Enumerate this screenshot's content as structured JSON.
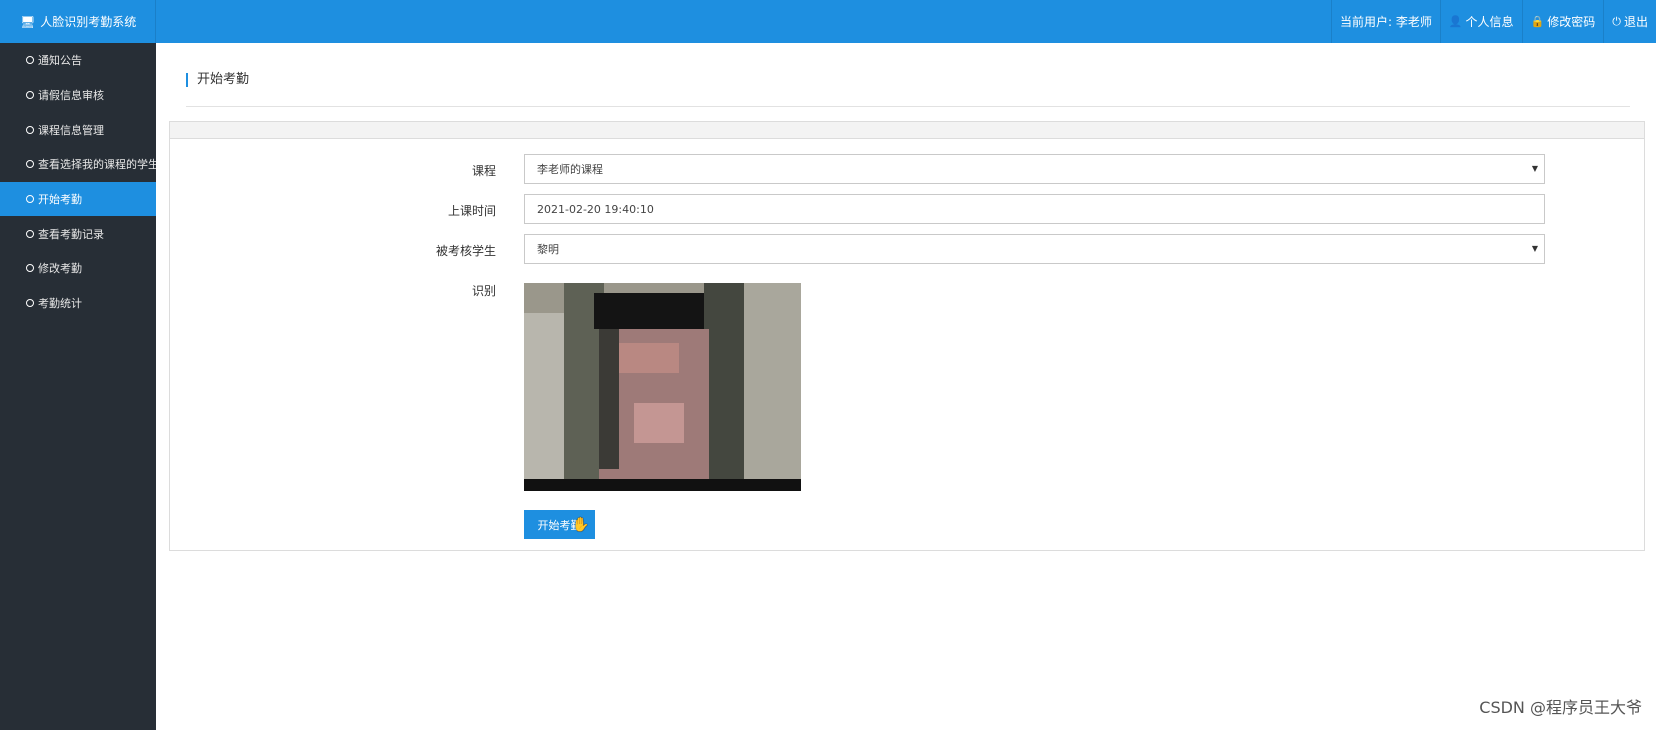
{
  "app": {
    "title": "人脸识别考勤系统",
    "icon": "monitor-icon"
  },
  "header": {
    "current_user": "当前用户: 李老师",
    "profile": "个人信息",
    "change_password": "修改密码",
    "logout": "退出"
  },
  "sidebar": {
    "items": [
      {
        "label": "通知公告"
      },
      {
        "label": "请假信息审核"
      },
      {
        "label": "课程信息管理"
      },
      {
        "label": "查看选择我的课程的学生"
      },
      {
        "label": "开始考勤",
        "active": true
      },
      {
        "label": "查看考勤记录"
      },
      {
        "label": "修改考勤"
      },
      {
        "label": "考勤统计"
      }
    ]
  },
  "page": {
    "title": "开始考勤"
  },
  "form": {
    "course_label": "课程",
    "course_value": "李老师的课程",
    "time_label": "上课时间",
    "time_value": "2021-02-20 19:40:10",
    "student_label": "被考核学生",
    "student_value": "黎明",
    "recognize_label": "识别",
    "start_button": "开始考勤"
  },
  "watermark": "CSDN @程序员王大爷",
  "colors": {
    "accent": "#1e8fe0",
    "sidebar_bg": "#272e36"
  }
}
